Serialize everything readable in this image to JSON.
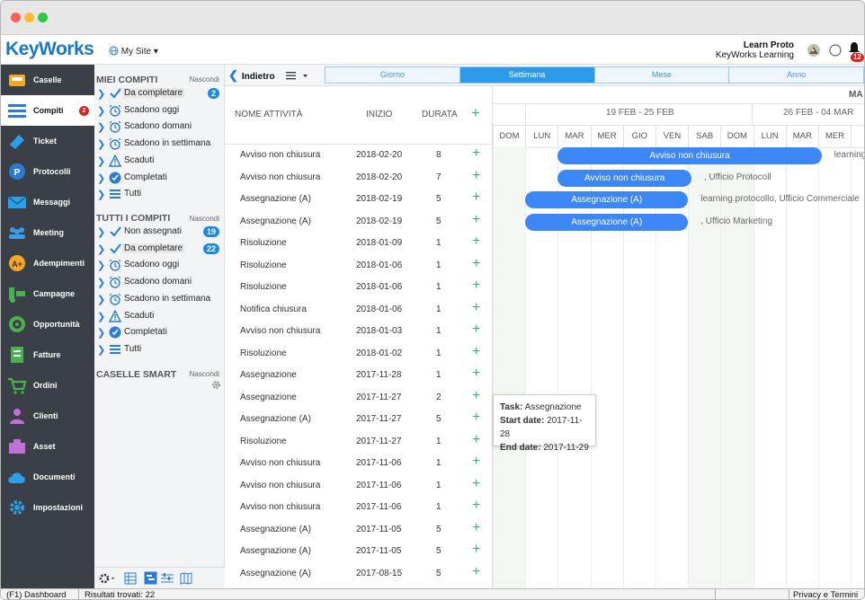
{
  "app": {
    "logo": "KeyWorks",
    "site": "My Site ▾",
    "user_name": "Learn Proto",
    "user_org": "KeyWorks Learning",
    "notif_count": "12"
  },
  "sidebar": {
    "items": [
      {
        "label": "Caselle",
        "icon": "inbox-icon"
      },
      {
        "label": "Compiti",
        "icon": "tasks-icon",
        "badge": "2"
      },
      {
        "label": "Ticket",
        "icon": "ticket-icon"
      },
      {
        "label": "Protocolli",
        "icon": "protocol-icon"
      },
      {
        "label": "Messaggi",
        "icon": "mail-icon"
      },
      {
        "label": "Meeting",
        "icon": "people-icon"
      },
      {
        "label": "Adempimenti",
        "icon": "compliance-icon"
      },
      {
        "label": "Campagne",
        "icon": "campaign-icon"
      },
      {
        "label": "Opportunità",
        "icon": "target-icon"
      },
      {
        "label": "Fatture",
        "icon": "invoice-icon"
      },
      {
        "label": "Ordini",
        "icon": "cart-icon"
      },
      {
        "label": "Clienti",
        "icon": "person-icon"
      },
      {
        "label": "Asset",
        "icon": "asset-icon"
      },
      {
        "label": "Documenti",
        "icon": "cloud-icon"
      },
      {
        "label": "Impostazioni",
        "icon": "gear-icon"
      }
    ]
  },
  "tree": {
    "my_title": "MIEI COMPITI",
    "hide": "Nascondi",
    "my_items": [
      {
        "label": "Da completare",
        "icon": "check-icon",
        "badge": "2"
      },
      {
        "label": "Scadono oggi",
        "icon": "alarm-icon"
      },
      {
        "label": "Scadono domani",
        "icon": "alarm-icon"
      },
      {
        "label": "Scadono in settimana",
        "icon": "alarm-icon"
      },
      {
        "label": "Scaduti",
        "icon": "warning-icon"
      },
      {
        "label": "Completati",
        "icon": "check-circle-icon"
      },
      {
        "label": "Tutti",
        "icon": "list-icon"
      }
    ],
    "all_title": "TUTTI I COMPITI",
    "all_items": [
      {
        "label": "Non assegnati",
        "icon": "check-icon",
        "badge": "19"
      },
      {
        "label": "Da completare",
        "icon": "check-icon",
        "badge": "22"
      },
      {
        "label": "Scadono oggi",
        "icon": "alarm-icon"
      },
      {
        "label": "Scadono domani",
        "icon": "alarm-icon"
      },
      {
        "label": "Scadono in settimana",
        "icon": "alarm-icon"
      },
      {
        "label": "Scaduti",
        "icon": "warning-icon"
      },
      {
        "label": "Completati",
        "icon": "check-circle-icon"
      },
      {
        "label": "Tutti",
        "icon": "list-icon"
      }
    ],
    "smart_title": "CASELLE SMART"
  },
  "nav": {
    "back": "Indietro",
    "tabs": [
      "Giorno",
      "Settimana",
      "Mese",
      "Anno"
    ],
    "active_tab": "Settimana"
  },
  "grid": {
    "headers": {
      "name": "NOME ATTIVITÀ",
      "start": "INIZIO",
      "duration": "DURATA",
      "add": "+"
    },
    "rows": [
      {
        "name": "Avviso non chiusura",
        "start": "2018-02-20",
        "dur": "8"
      },
      {
        "name": "Avviso non chiusura",
        "start": "2018-02-20",
        "dur": "7"
      },
      {
        "name": "Assegnazione (A)",
        "start": "2018-02-19",
        "dur": "5"
      },
      {
        "name": "Assegnazione (A)",
        "start": "2018-02-19",
        "dur": "5"
      },
      {
        "name": "Risoluzione",
        "start": "2018-01-09",
        "dur": "1"
      },
      {
        "name": "Risoluzione",
        "start": "2018-01-06",
        "dur": "1"
      },
      {
        "name": "Risoluzione",
        "start": "2018-01-06",
        "dur": "1"
      },
      {
        "name": "Notifica chiusura",
        "start": "2018-01-06",
        "dur": "1"
      },
      {
        "name": "Avviso non chiusura",
        "start": "2018-01-03",
        "dur": "1"
      },
      {
        "name": "Risoluzione",
        "start": "2018-01-02",
        "dur": "1"
      },
      {
        "name": "Assegnazione",
        "start": "2017-11-28",
        "dur": "1"
      },
      {
        "name": "Assegnazione",
        "start": "2017-11-27",
        "dur": "2"
      },
      {
        "name": "Assegnazione (A)",
        "start": "2017-11-27",
        "dur": "5"
      },
      {
        "name": "Risoluzione",
        "start": "2017-11-27",
        "dur": "1"
      },
      {
        "name": "Avviso non chiusura",
        "start": "2017-11-06",
        "dur": "1"
      },
      {
        "name": "Avviso non chiusura",
        "start": "2017-11-06",
        "dur": "1"
      },
      {
        "name": "Avviso non chiusura",
        "start": "2017-11-06",
        "dur": "1"
      },
      {
        "name": "Assegnazione (A)",
        "start": "2017-11-05",
        "dur": "5"
      },
      {
        "name": "Assegnazione (A)",
        "start": "2017-11-05",
        "dur": "5"
      },
      {
        "name": "Assegnazione (A)",
        "start": "2017-08-15",
        "dur": "5"
      }
    ]
  },
  "gantt": {
    "month_label": "MA",
    "weeks": [
      "19 FEB - 25 FEB",
      "26 FEB - 04 MAR"
    ],
    "days": [
      "DOM",
      "LUN",
      "MAR",
      "MER",
      "GIO",
      "VEN",
      "SAB",
      "DOM",
      "LUN",
      "MAR",
      "MER",
      "G"
    ],
    "bars": [
      {
        "label": "Avviso non chiusura",
        "after": "learning."
      },
      {
        "label": "Avviso non chiusura",
        "after": ", Ufficio Protocoll"
      },
      {
        "label": "Assegnazione (A)",
        "after": "learning.protocollo, Ufficio Commerciale"
      },
      {
        "label": "Assegnazione (A)",
        "after": ", Ufficio Marketing"
      }
    ],
    "tooltip": {
      "task_k": "Task:",
      "task_v": "Assegnazione",
      "start_k": "Start date:",
      "start_v": "2017-11-28",
      "end_k": "End date:",
      "end_v": "2017-11-29"
    }
  },
  "status": {
    "left": "(F1) Dashboard",
    "results": "Risultati trovati: 22",
    "right": "Privacy e Termini"
  }
}
